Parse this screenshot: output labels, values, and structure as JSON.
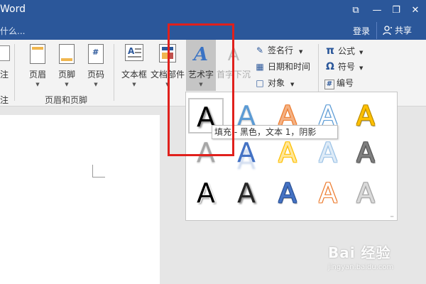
{
  "window": {
    "title": "Word",
    "controls": [
      "⧉",
      "—",
      "❐",
      "✕"
    ]
  },
  "tellbar": {
    "tell_me": "什么...",
    "login": "登录",
    "share": "共享"
  },
  "ribbon": {
    "partial_left": {
      "label_top": "注",
      "label_bottom": "注"
    },
    "header_footer_group": {
      "label": "页眉和页脚",
      "buttons": [
        {
          "label": "页眉"
        },
        {
          "label": "页脚"
        },
        {
          "label": "页码"
        }
      ]
    },
    "text_group": {
      "buttons": [
        {
          "label": "文本框"
        },
        {
          "label": "文档部件"
        },
        {
          "label": "艺术字"
        },
        {
          "label": "首字下沉"
        }
      ],
      "small_items": [
        {
          "label": "签名行",
          "icon": "signature-icon"
        },
        {
          "label": "日期和时间",
          "icon": "calendar-icon"
        },
        {
          "label": "对象",
          "icon": "object-icon"
        }
      ]
    },
    "symbols_group": {
      "items": [
        {
          "label": "公式",
          "glyph": "π"
        },
        {
          "label": "符号",
          "glyph": "Ω"
        },
        {
          "label": "编号",
          "glyph": "#"
        }
      ]
    }
  },
  "wordart_gallery": {
    "letter": "A",
    "tooltip": "填充 - 黑色，文本 1，阴影",
    "styles": [
      {
        "fill": "#000000",
        "stroke": "none",
        "style": "shadow"
      },
      {
        "fill": "#5b9bd5",
        "stroke": "none",
        "style": "gradient"
      },
      {
        "fill": "#f4b183",
        "stroke": "#ed7d31",
        "style": "outline"
      },
      {
        "fill": "#ffffff",
        "stroke": "#5b9bd5",
        "style": "outline"
      },
      {
        "fill": "#ffc000",
        "stroke": "#bf9000",
        "style": "bevel"
      },
      {
        "fill": "#a6a6a6",
        "stroke": "none",
        "style": "gradient"
      },
      {
        "fill": "#4472c4",
        "stroke": "none",
        "style": "reflection"
      },
      {
        "fill": "#ffe699",
        "stroke": "#ffc000",
        "style": "outline"
      },
      {
        "fill": "#deebf7",
        "stroke": "#9dc3e6",
        "style": "outline"
      },
      {
        "fill": "#7f7f7f",
        "stroke": "#595959",
        "style": "bevel"
      },
      {
        "fill": "#000000",
        "stroke": "#ffffff",
        "style": "shadow"
      },
      {
        "fill": "#262626",
        "stroke": "none",
        "style": "shadow"
      },
      {
        "fill": "#4472c4",
        "stroke": "#2f5597",
        "style": "bevel"
      },
      {
        "fill": "#ffffff",
        "stroke": "#ed7d31",
        "style": "outline"
      },
      {
        "fill": "#d9d9d9",
        "stroke": "#a6a6a6",
        "style": "gradient"
      }
    ]
  },
  "watermark": {
    "main": "Bai 经验",
    "sub": "jingyan.baidu.com"
  },
  "colors": {
    "accent": "#2b579a",
    "highlight": "#e0201c"
  }
}
